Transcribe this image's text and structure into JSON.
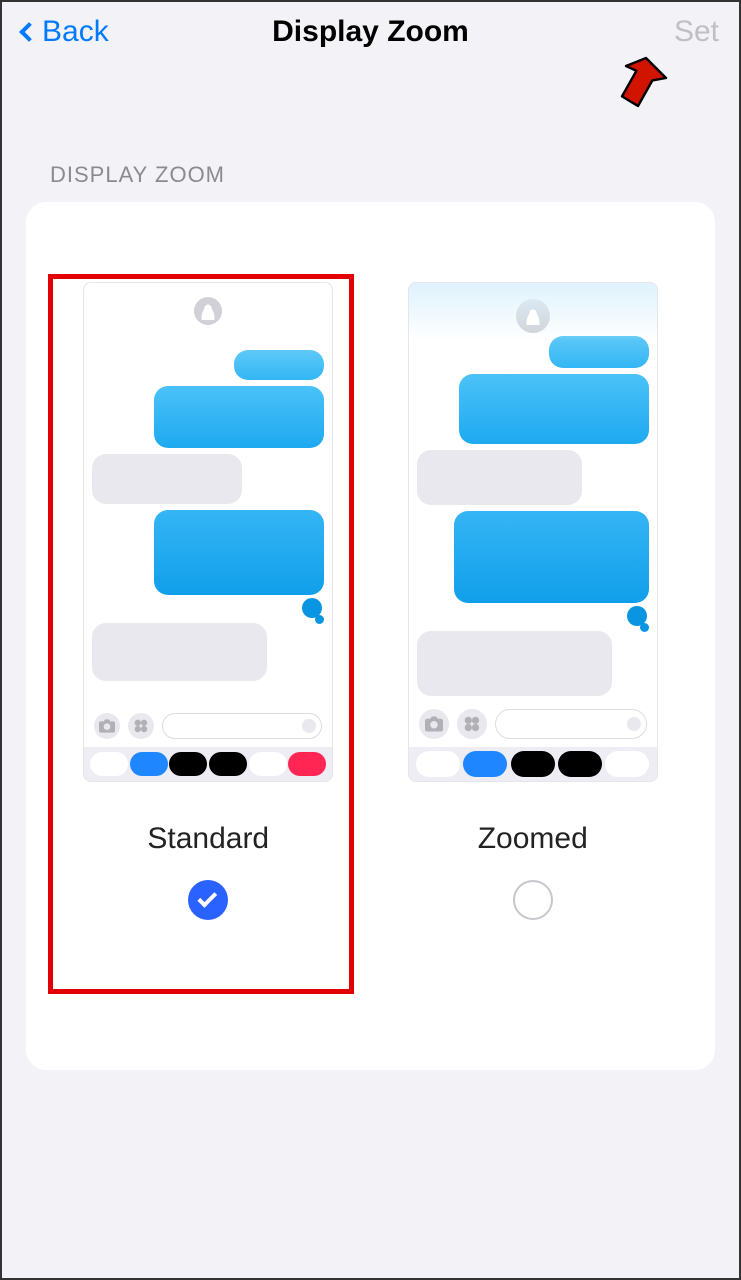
{
  "nav": {
    "back_label": "Back",
    "title": "Display Zoom",
    "set_label": "Set"
  },
  "section_header": "DISPLAY ZOOM",
  "options": {
    "standard": {
      "label": "Standard",
      "selected": true
    },
    "zoomed": {
      "label": "Zoomed",
      "selected": false
    }
  }
}
